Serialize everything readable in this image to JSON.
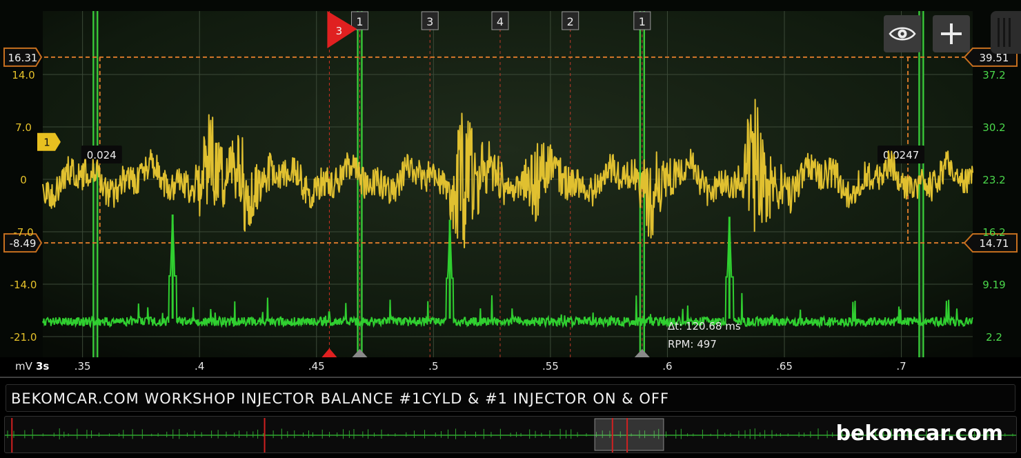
{
  "chart_data": {
    "type": "line",
    "x_unit": "3s",
    "y_unit": "mV",
    "xlim": [
      0.333,
      0.7305
    ],
    "x_ticks": [
      ".35",
      ".4",
      ".45",
      ".5",
      ".55",
      ".6",
      ".65",
      ".7"
    ],
    "x_tick_values": [
      0.35,
      0.4,
      0.45,
      0.5,
      0.55,
      0.6,
      0.65,
      0.7
    ],
    "left_axis": {
      "range": [
        -21.0,
        14.0
      ],
      "ticks": [
        "14.0",
        "7.0",
        "0",
        "-7.0",
        "-14.0",
        "-21.0"
      ],
      "color": "#e6c22a"
    },
    "right_axis": {
      "range": [
        2.2,
        37.2
      ],
      "ticks": [
        "37.2",
        "30.2",
        "23.2",
        "16.2",
        "9.19",
        "2.2"
      ],
      "color": "#4bd84b"
    },
    "series": [
      {
        "axis": "left",
        "color": "#e0c030",
        "baseline": 0,
        "bursts": [
          {
            "x": 0.4035,
            "amp": 6.5
          },
          {
            "x": 0.418,
            "amp": 4.0
          },
          {
            "x": 0.513,
            "amp": 9.0
          },
          {
            "x": 0.544,
            "amp": 3.5
          },
          {
            "x": 0.5925,
            "amp": 4.5
          },
          {
            "x": 0.6375,
            "amp": 8.5
          }
        ]
      },
      {
        "axis": "right",
        "color": "#30cf30",
        "baseline": 3.6,
        "spikes": [
          {
            "x": 0.3885,
            "top": 18.5
          },
          {
            "x": 0.507,
            "top": 17.8
          },
          {
            "x": 0.6265,
            "top": 18.2
          }
        ]
      }
    ],
    "cursors_horizontal": [
      {
        "left_label": "16.31",
        "right_label": "39.51",
        "y_left": 16.31
      },
      {
        "left_label": "-8.49",
        "right_label": "14.71",
        "y_left": -8.49
      }
    ],
    "cursors_vertical": [
      {
        "x": 0.3574,
        "value_label": "0.024"
      },
      {
        "x": 0.7028,
        "value_label": "0.0247"
      }
    ],
    "sync_lines": [
      0.3555,
      0.4685,
      0.5892,
      0.7085
    ],
    "cylinder_markers": [
      {
        "x": 0.4685,
        "label": "1"
      },
      {
        "x": 0.4985,
        "label": "3"
      },
      {
        "x": 0.5285,
        "label": "4"
      },
      {
        "x": 0.5585,
        "label": "2"
      },
      {
        "x": 0.5892,
        "label": "1"
      }
    ],
    "trigger_flag": {
      "x": 0.4555,
      "label": "3"
    },
    "channel_marker": {
      "label": "1",
      "y_left": 5.0
    },
    "measurement": {
      "delta_t": "Δt: 120.68 ms",
      "rpm": "RPM: 497"
    },
    "grid": true
  },
  "footer": {
    "title": "BEKOMCAR.COM WORKSHOP INJECTOR BALANCE #1CYLD & #1 INJECTOR ON & OFF",
    "watermark": "bekomcar.com"
  },
  "overview": {
    "window": [
      0.5825,
      0.6505
    ],
    "red_marks": [
      0.007,
      0.2565,
      0.6,
      0.6145
    ],
    "trace_color": "#2fa82f"
  },
  "controls": [
    {
      "name": "eye-icon"
    },
    {
      "name": "plus-icon"
    }
  ]
}
